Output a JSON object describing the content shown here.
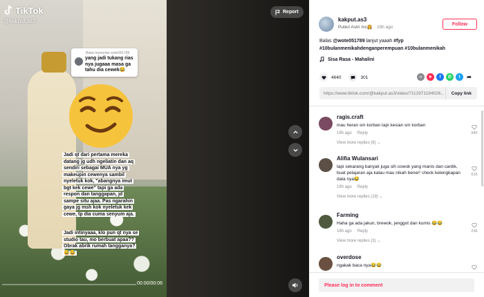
{
  "brand": {
    "name": "TikTok"
  },
  "video": {
    "author_handle": "@kakput.as3",
    "reply_header": "Balas komentar wote051789",
    "reply_text": "yang jadi tukang rias nya jugaaa masa ga tahu dia cewek😂",
    "caption_1": "Jadi qt dari pertama mereka datang jg udh ngeliatin dan aq sendiri sebagai MUA nya yg makeupin cewenya sambil nyeletuk kok, \"abangnya imut bgt kek cewe\" tapi ga ada respon dan tanggapan, jd sampe situ ajaa. Pas ngarahin gaya jg msh kok nyeletuk kek cewe, tp dia cuma senyum aja.",
    "caption_2": "Jadi intinyaaa, klo pun qt nya se studio tau, mo berbuat apaa?? Obrak abrik rumah tangganya? 😅😅",
    "time": "00:00/00:06",
    "progress_fraction": 0.0,
    "report_label": "Report"
  },
  "creator": {
    "username": "kakput.as3",
    "display_name": "Puteri Astri mc👸",
    "date": "19h ago",
    "follow_label": "Follow"
  },
  "description": {
    "prefix": "Balas",
    "mention": "@wote051789",
    "text": "lanjut yaaah",
    "tags": "#fyp #10bulanmenikahdenganperempuan #10bulanmenikah"
  },
  "music": {
    "title": "Sisa Rasa - Mahalini"
  },
  "stats": {
    "likes": "4640",
    "comments": "301"
  },
  "share": {
    "url": "https://www.tiktok.com/@kakput.as3/video/7112971194026...",
    "copy_label": "Copy link",
    "icons": [
      "embed-icon",
      "friends-icon",
      "facebook-icon",
      "whatsapp-icon",
      "twitter-icon",
      "share-arrow-icon"
    ]
  },
  "comments": [
    {
      "name": "ragis.craft",
      "text": "mau heran sm korban tapi kesian sm korban",
      "time": "19h ago",
      "reply": "Reply",
      "likes": "945",
      "replies": "View more replies (8)",
      "avatar_color": "#7a4a62"
    },
    {
      "name": "Alifia Wulansari",
      "text": "tapi sekarang banyak juga sih cowok yang manis dan cantik, buat pelajaran aja kalau mau nikah bener² check kelengkapan data nya😂",
      "time": "19h ago",
      "reply": "Reply",
      "likes": "615",
      "replies": "View more replies (18)",
      "avatar_color": "#5c5046"
    },
    {
      "name": "Farming",
      "text": "Haha ga ada jakun, brewok, jenggot dan kumis 😂😂",
      "time": "18h ago",
      "reply": "Reply",
      "likes": "236",
      "replies": "View more replies (3)",
      "avatar_color": "#4f5a3e"
    },
    {
      "name": "overdose",
      "text": "ngakak baca nya😂😂",
      "time": "",
      "reply": "",
      "likes": "",
      "replies": "",
      "avatar_color": "#6a5040"
    }
  ],
  "login": {
    "label": "Please log in to comment"
  },
  "colors": {
    "accent": "#fe2c55",
    "text": "#161823",
    "muted": "#8a8b91"
  }
}
